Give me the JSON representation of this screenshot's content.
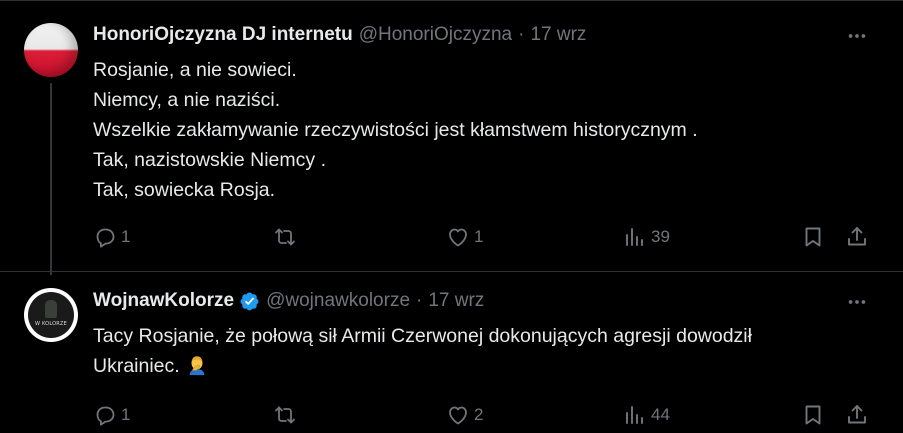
{
  "tweets": [
    {
      "display_name": "HonoriOjczyzna DJ internetu",
      "handle": "@HonoriOjczyzna",
      "separator": "·",
      "date": "17 wrz",
      "lines": [
        "Rosjanie, a nie sowieci.",
        "Niemcy, a nie naziści.",
        "Wszelkie zakłamywanie rzeczywistości jest kłamstwem historycznym .",
        "Tak, nazistowskie Niemcy .",
        "Tak, sowiecka Rosja."
      ],
      "actions": {
        "replies": "1",
        "retweets": "",
        "likes": "1",
        "views": "39"
      }
    },
    {
      "display_name": "WojnawKolorze",
      "handle": "@wojnawkolorze",
      "separator": "·",
      "date": "17 wrz",
      "verified": true,
      "avatar_text": "W KOLORZE",
      "lines": [
        "Tacy Rosjanie, że połową sił Armii Czerwonej dokonujących agresji dowodził",
        "Ukrainiec."
      ],
      "emoji": "man-facepalming",
      "actions": {
        "replies": "1",
        "retweets": "",
        "likes": "2",
        "views": "44"
      }
    }
  ],
  "colors": {
    "background": "#000000",
    "text_primary": "#e7e9ea",
    "text_secondary": "#71767b",
    "divider": "#2f3336",
    "verified_blue": "#1d9bf0"
  },
  "icons": {
    "more": "more-icon",
    "reply": "reply-icon",
    "retweet": "retweet-icon",
    "like": "heart-icon",
    "views": "views-icon",
    "bookmark": "bookmark-icon",
    "share": "share-icon",
    "verified": "verified-badge-icon"
  }
}
